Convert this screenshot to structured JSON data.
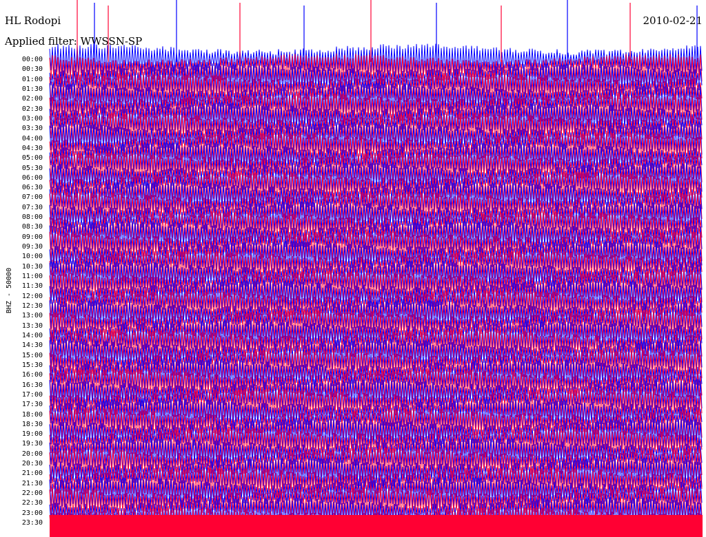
{
  "header": {
    "station": "HL Rodopi",
    "date": "2010-02-21",
    "filter_label": "Applied filter: WWSSN-SP"
  },
  "channel_label": "BHZ - 50000",
  "colors": {
    "trace_a": "#0000ff",
    "trace_b": "#ff0033",
    "background": "#ffffff",
    "text": "#000000"
  },
  "chart_data": {
    "type": "line",
    "title": "HL Rodopi",
    "chart_kind": "helicorder (seismogram drum plot)",
    "date": "2010-02-21",
    "filter": "WWSSN-SP",
    "channel": "BHZ - 50000",
    "ylabel": "BHZ - 50000",
    "row_interval_minutes": 30,
    "row_count": 48,
    "alternating_row_colors": [
      "#0000ff",
      "#ff0033"
    ],
    "tick_labels": [
      "00:00",
      "00:30",
      "01:00",
      "01:30",
      "02:00",
      "02:30",
      "03:00",
      "03:30",
      "04:00",
      "04:30",
      "05:00",
      "05:30",
      "06:00",
      "06:30",
      "07:00",
      "07:30",
      "08:00",
      "08:30",
      "09:00",
      "09:30",
      "10:00",
      "10:30",
      "11:00",
      "11:30",
      "12:00",
      "12:30",
      "13:00",
      "13:30",
      "14:00",
      "14:30",
      "15:00",
      "15:30",
      "16:00",
      "16:30",
      "17:00",
      "17:30",
      "18:00",
      "18:30",
      "19:00",
      "19:30",
      "20:00",
      "20:30",
      "21:00",
      "21:30",
      "22:00",
      "22:30",
      "23:00",
      "23:30"
    ],
    "grid": false,
    "legend": "none"
  }
}
